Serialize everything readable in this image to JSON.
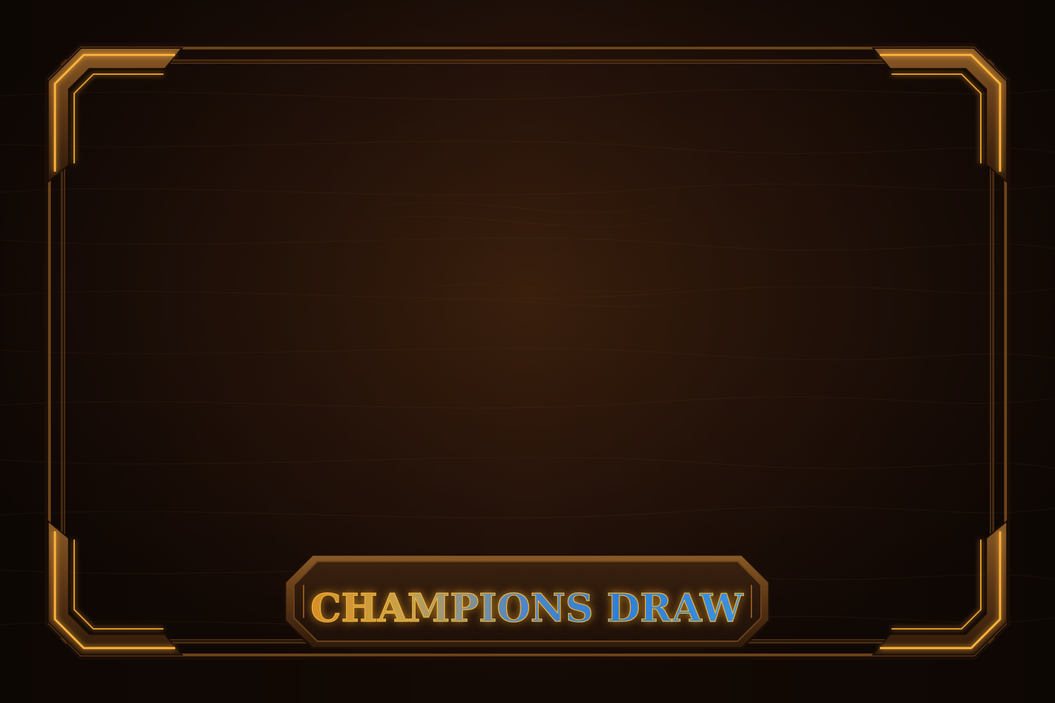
{
  "title": {
    "text": "CHAMPIONS DRAW"
  },
  "theme": {
    "background": "#26130a",
    "frame_gold": "#e69a2a",
    "frame_glow": "#ffb43a",
    "title_blue": "#2f7fd6"
  }
}
